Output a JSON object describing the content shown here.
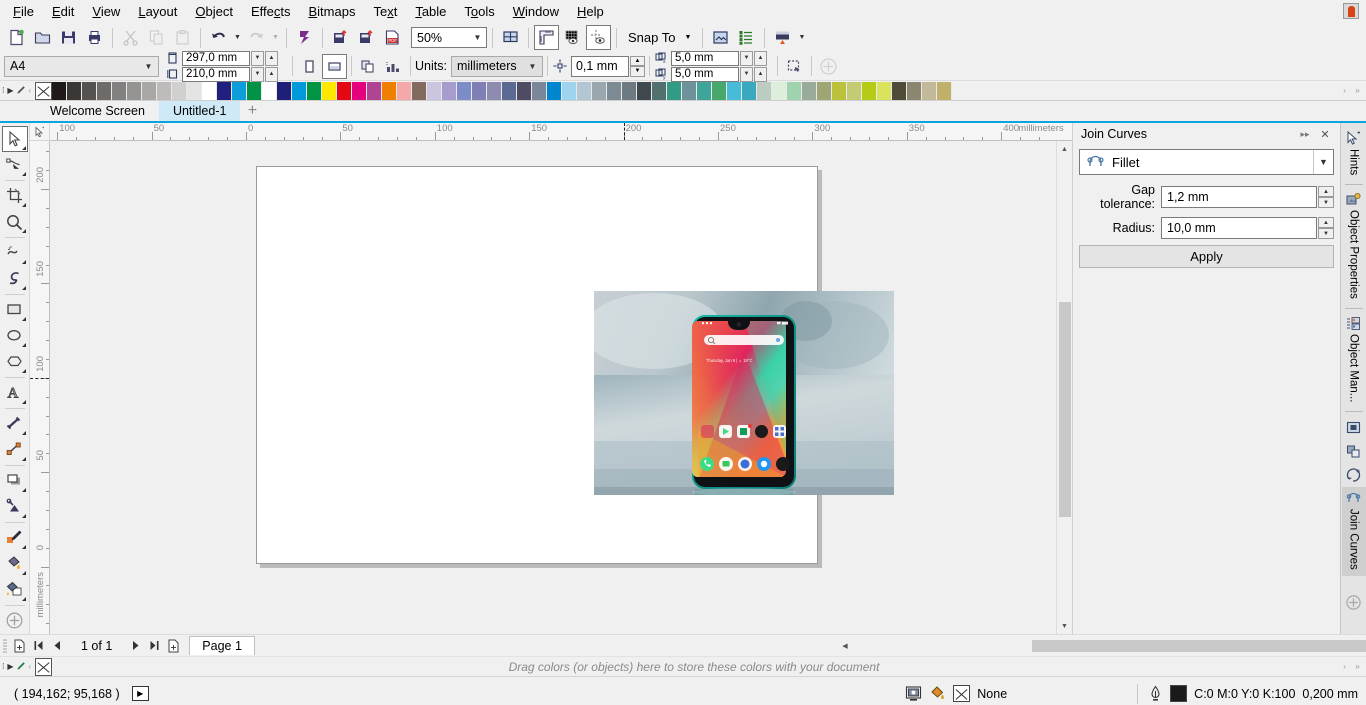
{
  "menu": {
    "items": [
      "File",
      "Edit",
      "View",
      "Layout",
      "Object",
      "Effects",
      "Bitmaps",
      "Text",
      "Table",
      "Tools",
      "Window",
      "Help"
    ]
  },
  "toolbar": {
    "new_label": "New",
    "open_label": "Open",
    "save_label": "Save",
    "print_label": "Print",
    "cut_label": "Cut",
    "copy_label": "Copy",
    "paste_label": "Paste",
    "undo_label": "Undo",
    "redo_label": "Redo",
    "search_content_label": "Search Content",
    "import_label": "Import",
    "export_label": "Export",
    "publish_pdf_label": "Publish to PDF",
    "zoom_level": "50%",
    "fullscreen_label": "Full-Screen Preview",
    "show_rulers_label": "Show Rulers",
    "show_grid_label": "Show Grid",
    "show_guides_label": "Show Guides",
    "snap_to_label": "Snap To",
    "options_label": "Options",
    "workspace_label": "Workspace",
    "application_launcher_label": "Application Launcher"
  },
  "propertybar": {
    "page_size": "A4",
    "page_width": "297,0 mm",
    "page_height": "210,0 mm",
    "portrait_label": "Portrait",
    "landscape_label": "Landscape",
    "all_pages_label": "All Pages",
    "current_page_label": "Current Page",
    "units_label": "Units:",
    "units_value": "millimeters",
    "nudge_value": "0,1 mm",
    "duplicate_x": "5,0 mm",
    "duplicate_y": "5,0 mm",
    "treat_as_filled_label": "Treat All Objects as Filled",
    "options_label": "Options"
  },
  "tabs": {
    "documents": [
      {
        "label": "Welcome Screen",
        "active": false
      },
      {
        "label": "Untitled-1",
        "active": true
      }
    ],
    "add_label": "+"
  },
  "toolbox": {
    "tools": [
      {
        "name": "pick-tool",
        "label": "Pick",
        "selected": true
      },
      {
        "name": "shape-tool",
        "label": "Shape",
        "selected": false
      },
      {
        "name": "crop-tool",
        "label": "Crop",
        "selected": false
      },
      {
        "name": "zoom-tool",
        "label": "Zoom",
        "selected": false
      },
      {
        "name": "freehand-tool",
        "label": "Freehand",
        "selected": false
      },
      {
        "name": "artistic-media-tool",
        "label": "Artistic Media",
        "selected": false
      },
      {
        "name": "rectangle-tool",
        "label": "Rectangle",
        "selected": false
      },
      {
        "name": "ellipse-tool",
        "label": "Ellipse",
        "selected": false
      },
      {
        "name": "polygon-tool",
        "label": "Polygon",
        "selected": false
      },
      {
        "name": "text-tool",
        "label": "Text",
        "selected": false
      },
      {
        "name": "parallel-dimension-tool",
        "label": "Parallel Dimension",
        "selected": false
      },
      {
        "name": "straight-line-connector-tool",
        "label": "Straight-Line Connector",
        "selected": false
      },
      {
        "name": "drop-shadow-tool",
        "label": "Drop Shadow",
        "selected": false
      },
      {
        "name": "transparency-tool",
        "label": "Transparency",
        "selected": false
      },
      {
        "name": "color-eyedropper-tool",
        "label": "Color Eyedropper",
        "selected": false
      },
      {
        "name": "interactive-fill-tool",
        "label": "Interactive Fill",
        "selected": false
      },
      {
        "name": "smart-fill-tool",
        "label": "Smart Fill",
        "selected": false
      },
      {
        "name": "quick-customize",
        "label": "Quick Customize",
        "selected": false
      }
    ]
  },
  "rulers": {
    "horizontal_labels": [
      "100",
      "50",
      "0",
      "50",
      "100",
      "150",
      "200",
      "250",
      "300",
      "350",
      "400"
    ],
    "horizontal_unit": "millimeters",
    "vertical_labels": [
      "200",
      "150",
      "100",
      "50",
      "0"
    ],
    "vertical_unit": "millimeters"
  },
  "docker": {
    "title": "Join Curves",
    "collapse_label": "▸▸",
    "close_label": "✕",
    "mode_value": "Fillet",
    "gap_tolerance_label": "Gap tolerance:",
    "gap_tolerance_value": "1,2 mm",
    "radius_label": "Radius:",
    "radius_value": "10,0 mm",
    "apply_label": "Apply",
    "side_tabs": [
      {
        "label": "Hints",
        "icon": "cursor-hint-icon",
        "active": false
      },
      {
        "label": "Object Properties",
        "icon": "object-properties-icon",
        "active": false
      },
      {
        "label": "Object Man...",
        "icon": "object-manager-icon",
        "active": false
      },
      {
        "label": "Join Curves",
        "icon": "join-curves-icon",
        "active": true
      }
    ],
    "side_icon_only": [
      {
        "name": "frame-icon"
      },
      {
        "name": "shaping-icon"
      },
      {
        "name": "transform-icon"
      },
      {
        "name": "quick-customize-plus-icon"
      }
    ]
  },
  "pagenav": {
    "add_page_start_label": "New Page Before",
    "first_label": "First Page",
    "prev_label": "Previous Page",
    "counter": "1 of 1",
    "next_label": "Next Page",
    "last_label": "Last Page",
    "add_page_end_label": "New Page After",
    "page_tab": "Page 1"
  },
  "palette": {
    "bottom_hint": "Drag colors (or objects) here to store these colors with your document",
    "none_label": "No color",
    "top_colors": [
      "#1f1a17",
      "#3b3734",
      "#555250",
      "#6e6b69",
      "#828180",
      "#959493",
      "#a9a8a7",
      "#bdbcbb",
      "#d1d0cf",
      "#e4e4e3",
      "#ffffff",
      "#22207f",
      "#0d9ddb",
      "#009245",
      "#ffffff",
      "#1f1f7a",
      "#0099da",
      "#009444",
      "#ffe800",
      "#e30613",
      "#e5007d",
      "#b14492",
      "#ee7f00",
      "#f4a9a8",
      "#836a5e",
      "#ccc5e0",
      "#a89cce",
      "#7b8cc8",
      "#7f7fb5",
      "#8d8cb0",
      "#5b6a93",
      "#4e4b63",
      "#7b8699",
      "#0086cf",
      "#9fd4ee",
      "#b2c6d3",
      "#9aa7ad",
      "#7b8a93",
      "#6d7a82",
      "#3f484f",
      "#52706e",
      "#329b85",
      "#6d9299",
      "#3fa59b",
      "#48a86c",
      "#46bcd8",
      "#3aa8bd",
      "#bcccc0",
      "#ddeedd",
      "#9ed3ae",
      "#9aab9a",
      "#9fa673",
      "#bcc13c",
      "#c3cc74",
      "#b4cc16",
      "#dbe35c",
      "#4f4b38",
      "#8b8670",
      "#c2b89a",
      "#c0b06a"
    ]
  },
  "statusbar": {
    "coords": "( 194,162; 95,168 )",
    "play_label": "▶",
    "fill_label": "Fill",
    "fill_value": "None",
    "outline_color_label": "Outline",
    "outline_value": "C:0 M:0 Y:0 K:100",
    "outline_width": "0,200 mm",
    "snapshot_label": "Snapshot"
  },
  "photo": {
    "alt": "Smartphone on a table with colorful home screen wallpaper",
    "screen_text_status": "Thursday, Jan 9 | 18°C",
    "search_placeholder": "Search"
  },
  "colors": {
    "accent": "#0aa3e0",
    "tab_active_bg": "#cfe9f7",
    "chrome_bg": "#f0f0f0",
    "outline_chip": "#1a1a1a"
  }
}
